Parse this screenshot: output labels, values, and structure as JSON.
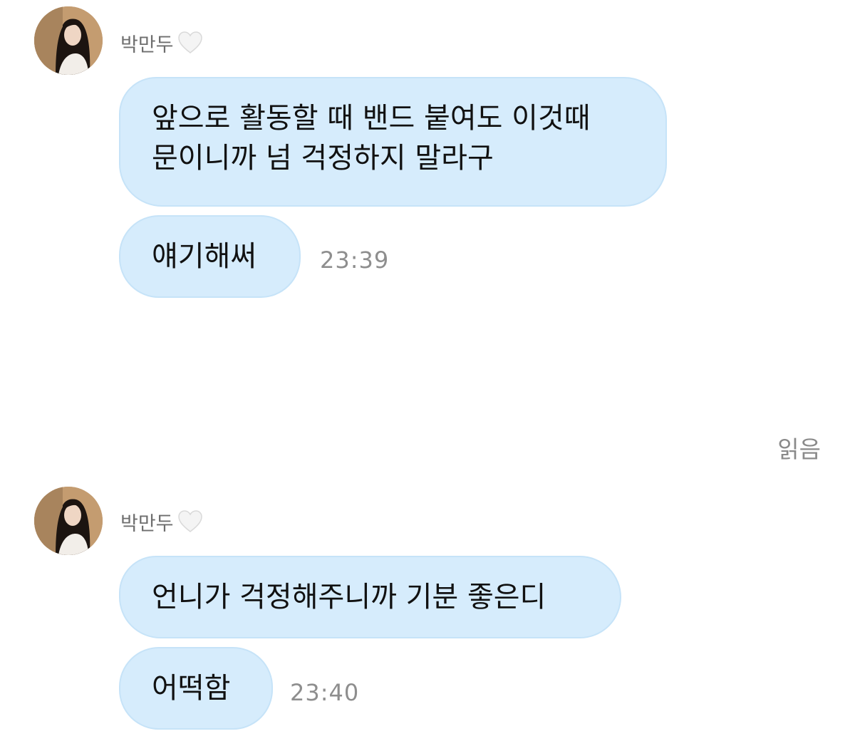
{
  "sender": {
    "name": "박만두",
    "heart_icon": "white-heart-icon",
    "avatar_icon": "profile-photo"
  },
  "messages": [
    {
      "lines": [
        "앞으로 활동할 때 밴드 붙여도 이것때",
        "문이니까 넘 걱정하지 말라구"
      ]
    },
    {
      "lines": [
        "얘기해써"
      ],
      "time": "23:39"
    },
    {
      "lines": [
        "언니가 걱정해주니까 기분 좋은디"
      ]
    },
    {
      "lines": [
        "어떡함"
      ],
      "time": "23:40"
    }
  ],
  "read_status": "읽음",
  "colors": {
    "bubble": "#d6ecfc",
    "bubble_border": "#c6e3f8",
    "timestamp": "#8e8e8e",
    "sender_name": "#6e6e6e"
  }
}
